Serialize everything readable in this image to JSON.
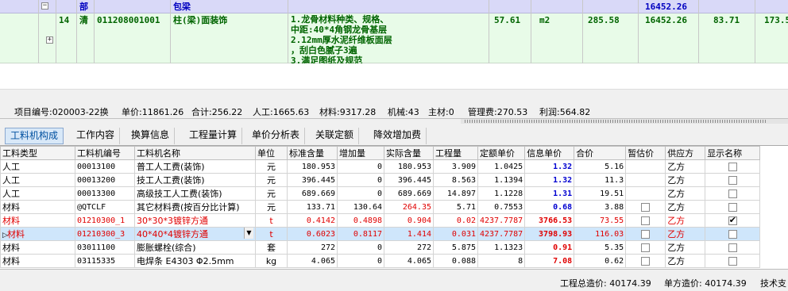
{
  "top_grid": {
    "section_row": {
      "kind": "部",
      "name": "包梁",
      "total": "16452.26"
    },
    "item_row": {
      "index": "14",
      "kind": "清",
      "code": "011208001001",
      "name": "柱(梁)面装饰",
      "features": [
        "1.龙骨材料种类、规格、",
        "中距:40*4角钢龙骨基层",
        "2.12mm厚水泥纤维板面层",
        "，刮白色腻子3遍",
        "3.满足图纸及规范"
      ],
      "quantity": "57.61",
      "unit": "m2",
      "unit_price": "285.58",
      "total": "16452.26",
      "col_a": "83.71",
      "col_b": "173.5"
    }
  },
  "info_bar": {
    "project_no": "项目编号:020003-22换",
    "unit_price": "单价:11861.26",
    "subtotal": "合计:256.22",
    "labor": "人工:1665.63",
    "material": "材料:9317.28",
    "machine": "机械:43",
    "main_material": "主材:0",
    "mgmt_fee": "管理费:270.53",
    "profit": "利润:564.82"
  },
  "tabs": [
    {
      "label": "工料机构成",
      "active": true
    },
    {
      "label": "工作内容"
    },
    {
      "label": "换算信息"
    },
    {
      "label": "工程量计算"
    },
    {
      "label": "单价分析表"
    },
    {
      "label": "关联定额"
    },
    {
      "label": "降效增加费"
    }
  ],
  "table": {
    "headers": [
      "工料类型",
      "工料机编号",
      "工料机名称",
      "单位",
      "标准含量",
      "增加量",
      "实际含量",
      "工程量",
      "定额单价",
      "信息单价",
      "合价",
      "暂估价",
      "供应方",
      "显示名称"
    ],
    "rows": [
      {
        "type": "人工",
        "code": "00013100",
        "name": "普工人工费(装饰)",
        "unit": "元",
        "std": "180.953",
        "add": "0",
        "actual": "180.953",
        "qty": "3.909",
        "quota_price": "1.0425",
        "info_price": "1.32",
        "total": "5.16",
        "has_est": false,
        "supplier": "乙方",
        "show": false
      },
      {
        "type": "人工",
        "code": "00013200",
        "name": "技工人工费(装饰)",
        "unit": "元",
        "std": "396.445",
        "add": "0",
        "actual": "396.445",
        "qty": "8.563",
        "quota_price": "1.1394",
        "info_price": "1.32",
        "total": "11.3",
        "has_est": false,
        "supplier": "乙方",
        "show": false
      },
      {
        "type": "人工",
        "code": "00013300",
        "name": "高级技工人工费(装饰)",
        "unit": "元",
        "std": "689.669",
        "add": "0",
        "actual": "689.669",
        "qty": "14.897",
        "quota_price": "1.1228",
        "info_price": "1.31",
        "total": "19.51",
        "has_est": false,
        "supplier": "乙方",
        "show": false
      },
      {
        "type": "材料",
        "code": "@QTCLF",
        "name": "其它材料费(按百分比计算)",
        "unit": "元",
        "std": "133.71",
        "add": "130.64",
        "actual": "264.35",
        "qty": "5.71",
        "quota_price": "0.7553",
        "info_price": "0.68",
        "total": "3.88",
        "has_est": true,
        "supplier": "乙方",
        "show": false,
        "actual_red": true
      },
      {
        "type": "材料",
        "code": "01210300_1",
        "name": "30*30*3镀锌方通",
        "unit": "t",
        "std": "0.4142",
        "add": "0.4898",
        "actual": "0.904",
        "qty": "0.02",
        "quota_price": "4237.7787",
        "info_price": "3766.53",
        "total": "73.55",
        "has_est": true,
        "supplier": "乙方",
        "show": true,
        "style": "red"
      },
      {
        "type": "材料",
        "code": "01210300_3",
        "name": "40*40*4镀锌方通",
        "unit": "t",
        "std": "0.6023",
        "add": "0.8117",
        "actual": "1.414",
        "qty": "0.031",
        "quota_price": "4237.7787",
        "info_price": "3798.93",
        "total": "116.03",
        "has_est": true,
        "supplier": "乙方",
        "show": false,
        "style": "sel"
      },
      {
        "type": "材料",
        "code": "03011100",
        "name": "膨胀螺栓(综合)",
        "unit": "套",
        "std": "272",
        "add": "0",
        "actual": "272",
        "qty": "5.875",
        "quota_price": "1.1323",
        "info_price": "0.91",
        "total": "5.35",
        "has_est": true,
        "supplier": "乙方",
        "show": false,
        "info_red": true
      },
      {
        "type": "材料",
        "code": "03115335",
        "name": "电焊条 E4303 Φ2.5mm",
        "unit": "kg",
        "std": "4.065",
        "add": "0",
        "actual": "4.065",
        "qty": "0.088",
        "quota_price": "8",
        "info_price": "7.08",
        "total": "0.62",
        "has_est": true,
        "supplier": "乙方",
        "show": false,
        "info_red": true
      }
    ]
  },
  "status_bar": {
    "project_total": "工程总造价: 40174.39",
    "unit_cost": "单方造价: 40174.39",
    "tech": "技术支"
  },
  "colors": {
    "accent_red": "#e00000",
    "price_blue": "#0000d0",
    "selected_row": "#cfe6fb",
    "item_green": "#e8fbe8",
    "section_blue": "#d9d9f8"
  }
}
